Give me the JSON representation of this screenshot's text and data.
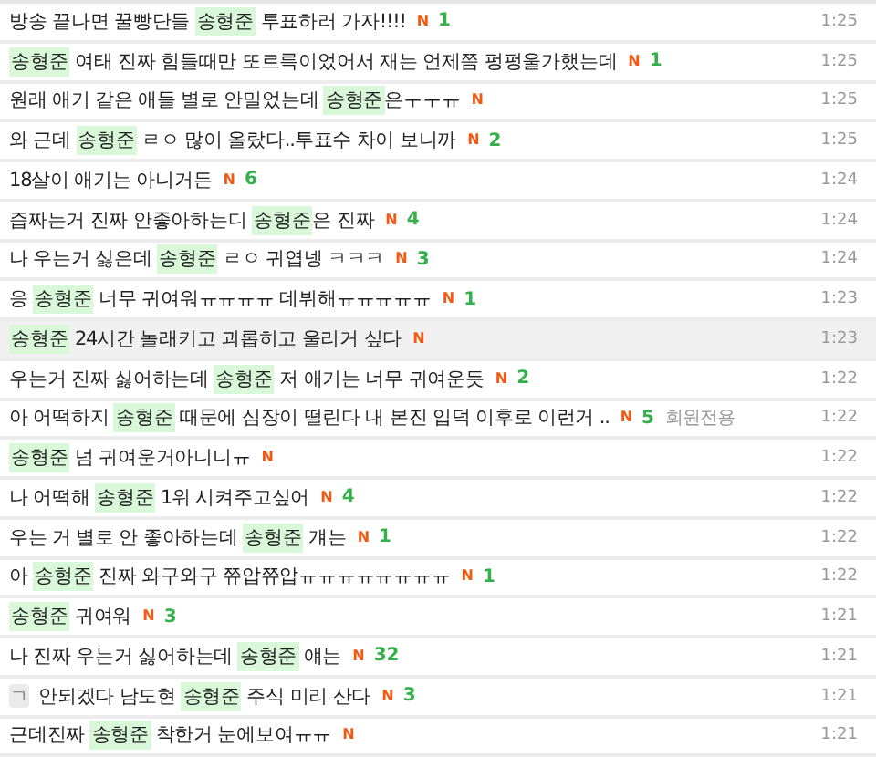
{
  "posts": [
    {
      "selected": false,
      "segments": [
        {
          "text": "방송 끝나면 꿀빵단들 ",
          "highlight": false
        },
        {
          "text": "송형준",
          "highlight": true
        },
        {
          "text": " 투표하러 가자!!!!",
          "highlight": false
        }
      ],
      "badge": "N",
      "comments": "1",
      "time": "1:25"
    },
    {
      "selected": false,
      "segments": [
        {
          "text": "송형준",
          "highlight": true
        },
        {
          "text": " 여태 진짜 힘들때만 또르륵이었어서 재는 언제쯤 펑펑울가했는데",
          "highlight": false
        }
      ],
      "badge": "N",
      "comments": "1",
      "time": "1:25"
    },
    {
      "selected": false,
      "segments": [
        {
          "text": "원래 애기 같은 애들 별로 안밀었는데 ",
          "highlight": false
        },
        {
          "text": "송형준",
          "highlight": true
        },
        {
          "text": "은ㅜㅜㅠ",
          "highlight": false
        }
      ],
      "badge": "N",
      "time": "1:25"
    },
    {
      "selected": false,
      "segments": [
        {
          "text": "와 근데 ",
          "highlight": false
        },
        {
          "text": "송형준",
          "highlight": true
        },
        {
          "text": " ㄹㅇ 많이 올랐다..투표수 차이 보니까",
          "highlight": false
        }
      ],
      "badge": "N",
      "comments": "2",
      "time": "1:25"
    },
    {
      "selected": false,
      "segments": [
        {
          "text": "18살이 애기는 아니거든",
          "highlight": false
        }
      ],
      "badge": "N",
      "comments": "6",
      "time": "1:24"
    },
    {
      "selected": false,
      "segments": [
        {
          "text": "즙짜는거 진짜 안좋아하는디 ",
          "highlight": false
        },
        {
          "text": "송형준",
          "highlight": true
        },
        {
          "text": "은 진짜",
          "highlight": false
        }
      ],
      "badge": "N",
      "comments": "4",
      "time": "1:24"
    },
    {
      "selected": false,
      "segments": [
        {
          "text": "나 우는거 싫은데 ",
          "highlight": false
        },
        {
          "text": "송형준",
          "highlight": true
        },
        {
          "text": " ㄹㅇ 귀엽넹 ㅋㅋㅋ",
          "highlight": false
        }
      ],
      "badge": "N",
      "comments": "3",
      "time": "1:24"
    },
    {
      "selected": false,
      "segments": [
        {
          "text": "응 ",
          "highlight": false
        },
        {
          "text": "송형준",
          "highlight": true
        },
        {
          "text": " 너무 귀여워ㅠㅠㅠㅠ 데뷔해ㅠㅠㅠㅠㅠ",
          "highlight": false
        }
      ],
      "badge": "N",
      "comments": "1",
      "time": "1:23"
    },
    {
      "selected": true,
      "segments": [
        {
          "text": "송형준",
          "highlight": true
        },
        {
          "text": " 24시간 놀래키고 괴롭히고 울리거 싶다",
          "highlight": false
        }
      ],
      "badge": "N",
      "time": "1:23"
    },
    {
      "selected": false,
      "segments": [
        {
          "text": "우는거 진짜 싫어하는데 ",
          "highlight": false
        },
        {
          "text": "송형준",
          "highlight": true
        },
        {
          "text": " 저 애기는 너무 귀여운듯",
          "highlight": false
        }
      ],
      "badge": "N",
      "comments": "2",
      "time": "1:22"
    },
    {
      "selected": false,
      "segments": [
        {
          "text": "아 어떡하지 ",
          "highlight": false
        },
        {
          "text": "송형준",
          "highlight": true
        },
        {
          "text": " 때문에 심장이 떨린다 내 본진 입덕 이후로 이런거 ..",
          "highlight": false
        }
      ],
      "badge": "N",
      "comments": "5",
      "tag": "회원전용",
      "time": "1:22"
    },
    {
      "selected": false,
      "segments": [
        {
          "text": "송형준",
          "highlight": true
        },
        {
          "text": " 넘 귀여운거아니니ㅠ",
          "highlight": false
        }
      ],
      "badge": "N",
      "time": "1:22"
    },
    {
      "selected": false,
      "segments": [
        {
          "text": "나 어떡해 ",
          "highlight": false
        },
        {
          "text": "송형준",
          "highlight": true
        },
        {
          "text": " 1위 시켜주고싶어",
          "highlight": false
        }
      ],
      "badge": "N",
      "comments": "4",
      "time": "1:22"
    },
    {
      "selected": false,
      "segments": [
        {
          "text": "우는 거 별로 안 좋아하는데 ",
          "highlight": false
        },
        {
          "text": "송형준",
          "highlight": true
        },
        {
          "text": " 걔는",
          "highlight": false
        }
      ],
      "badge": "N",
      "comments": "1",
      "time": "1:22"
    },
    {
      "selected": false,
      "segments": [
        {
          "text": "아 ",
          "highlight": false
        },
        {
          "text": "송형준",
          "highlight": true
        },
        {
          "text": " 진짜 와구와구 쮸압쮸압ㅠㅠㅠㅠㅠㅠㅠㅠ",
          "highlight": false
        }
      ],
      "badge": "N",
      "comments": "1",
      "time": "1:22"
    },
    {
      "selected": false,
      "segments": [
        {
          "text": "송형준",
          "highlight": true
        },
        {
          "text": " 귀여워",
          "highlight": false
        }
      ],
      "badge": "N",
      "comments": "3",
      "time": "1:21"
    },
    {
      "selected": false,
      "segments": [
        {
          "text": "나 진짜 우는거 싫어하는데 ",
          "highlight": false
        },
        {
          "text": "송형준",
          "highlight": true
        },
        {
          "text": " 얘는",
          "highlight": false
        }
      ],
      "badge": "N",
      "comments": "32",
      "time": "1:21"
    },
    {
      "selected": false,
      "prefix": "ㄱ",
      "segments": [
        {
          "text": "안되겠다 남도현 ",
          "highlight": false
        },
        {
          "text": "송형준",
          "highlight": true
        },
        {
          "text": " 주식 미리 산다",
          "highlight": false
        }
      ],
      "badge": "N",
      "comments": "3",
      "time": "1:21"
    },
    {
      "selected": false,
      "segments": [
        {
          "text": "근데진짜 ",
          "highlight": false
        },
        {
          "text": "송형준",
          "highlight": true
        },
        {
          "text": " 착한거 눈에보여ㅠㅠ",
          "highlight": false
        }
      ],
      "badge": "N",
      "time": "1:21"
    }
  ]
}
